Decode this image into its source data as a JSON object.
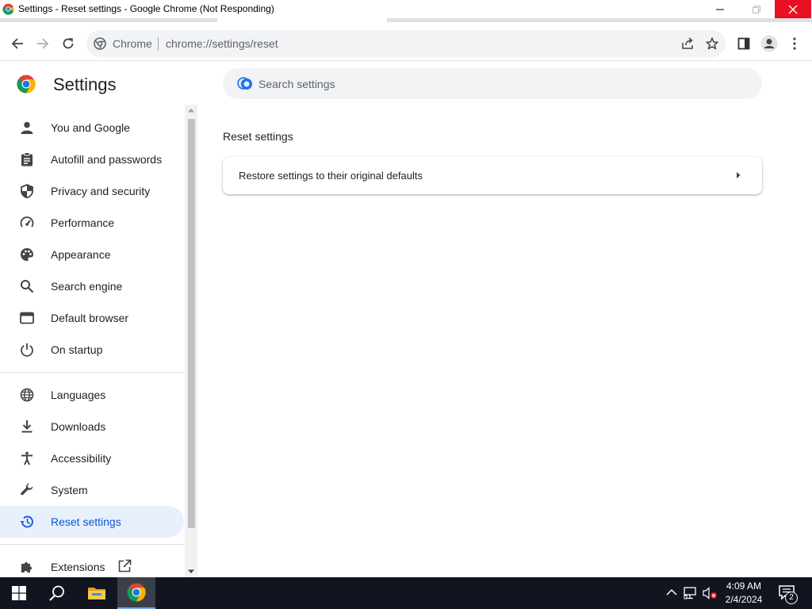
{
  "window": {
    "title": "Settings - Reset settings - Google Chrome (Not Responding)"
  },
  "toolbar": {
    "omnibox_chip": "Chrome",
    "url": "chrome://settings/reset"
  },
  "settings": {
    "title": "Settings",
    "search_placeholder": "Search settings"
  },
  "sidebar": {
    "items": [
      {
        "label": "You and Google",
        "icon": "person-icon"
      },
      {
        "label": "Autofill and passwords",
        "icon": "clipboard-icon"
      },
      {
        "label": "Privacy and security",
        "icon": "shield-icon"
      },
      {
        "label": "Performance",
        "icon": "gauge-icon"
      },
      {
        "label": "Appearance",
        "icon": "palette-icon"
      },
      {
        "label": "Search engine",
        "icon": "search-icon"
      },
      {
        "label": "Default browser",
        "icon": "browser-window-icon"
      },
      {
        "label": "On startup",
        "icon": "power-icon"
      },
      {
        "label": "Languages",
        "icon": "globe-icon"
      },
      {
        "label": "Downloads",
        "icon": "download-icon"
      },
      {
        "label": "Accessibility",
        "icon": "accessibility-icon"
      },
      {
        "label": "System",
        "icon": "wrench-icon"
      },
      {
        "label": "Reset settings",
        "icon": "history-icon",
        "active": true
      },
      {
        "label": "Extensions",
        "icon": "puzzle-icon"
      }
    ]
  },
  "main": {
    "section_title": "Reset settings",
    "rows": [
      {
        "label": "Restore settings to their original defaults"
      }
    ]
  },
  "taskbar": {
    "time": "4:09 AM",
    "date": "2/4/2024",
    "notification_count": "2"
  },
  "colors": {
    "accent": "#0b57d0",
    "active_bg": "#e8f0fe",
    "close_red": "#e81123",
    "taskbar_bg": "#10151f"
  }
}
